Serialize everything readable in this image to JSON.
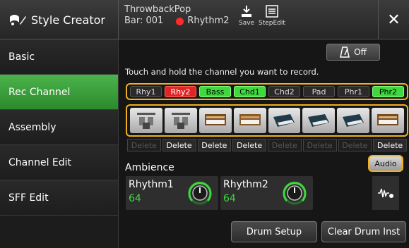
{
  "header": {
    "title": "Style Creator",
    "style_name": "ThrowbackPop",
    "bar_label": "Bar: 001",
    "rec_channel_label": "Rhythm2",
    "save_label": "Save",
    "stepedit_label": "StepEdit",
    "close_label": "✕"
  },
  "sidebar": {
    "items": [
      {
        "label": "Basic"
      },
      {
        "label": "Rec Channel"
      },
      {
        "label": "Assembly"
      },
      {
        "label": "Channel Edit"
      },
      {
        "label": "SFF Edit"
      }
    ]
  },
  "main": {
    "metronome_label": "Off",
    "hint": "Touch and hold the channel you want to record.",
    "channels": [
      {
        "label": "Rhy1",
        "state": "off"
      },
      {
        "label": "Rhy2",
        "state": "rec"
      },
      {
        "label": "Bass",
        "state": "on"
      },
      {
        "label": "Chd1",
        "state": "on"
      },
      {
        "label": "Chd2",
        "state": "off"
      },
      {
        "label": "Pad",
        "state": "off"
      },
      {
        "label": "Phr1",
        "state": "off"
      },
      {
        "label": "Phr2",
        "state": "on"
      }
    ],
    "voices": [
      "drum-kit-icon",
      "drum-kit-icon",
      "organ-icon",
      "organ-icon",
      "synth-keyboard-icon",
      "synth-keyboard-icon",
      "synth-keyboard-icon",
      "organ-icon"
    ],
    "delete": [
      {
        "label": "Delete",
        "enabled": false
      },
      {
        "label": "Delete",
        "enabled": true
      },
      {
        "label": "Delete",
        "enabled": true
      },
      {
        "label": "Delete",
        "enabled": true
      },
      {
        "label": "Delete",
        "enabled": false
      },
      {
        "label": "Delete",
        "enabled": false
      },
      {
        "label": "Delete",
        "enabled": false
      },
      {
        "label": "Delete",
        "enabled": true
      }
    ],
    "ambience_label": "Ambience",
    "audio_label": "Audio",
    "ambience": [
      {
        "name": "Rhythm1",
        "value": "64"
      },
      {
        "name": "Rhythm2",
        "value": "64"
      }
    ],
    "drum_setup_label": "Drum Setup",
    "clear_drum_label": "Clear Drum Inst"
  },
  "colors": {
    "accent_green": "#3fd93f",
    "rec_red": "#e02525",
    "highlight_orange": "#f0b020"
  }
}
